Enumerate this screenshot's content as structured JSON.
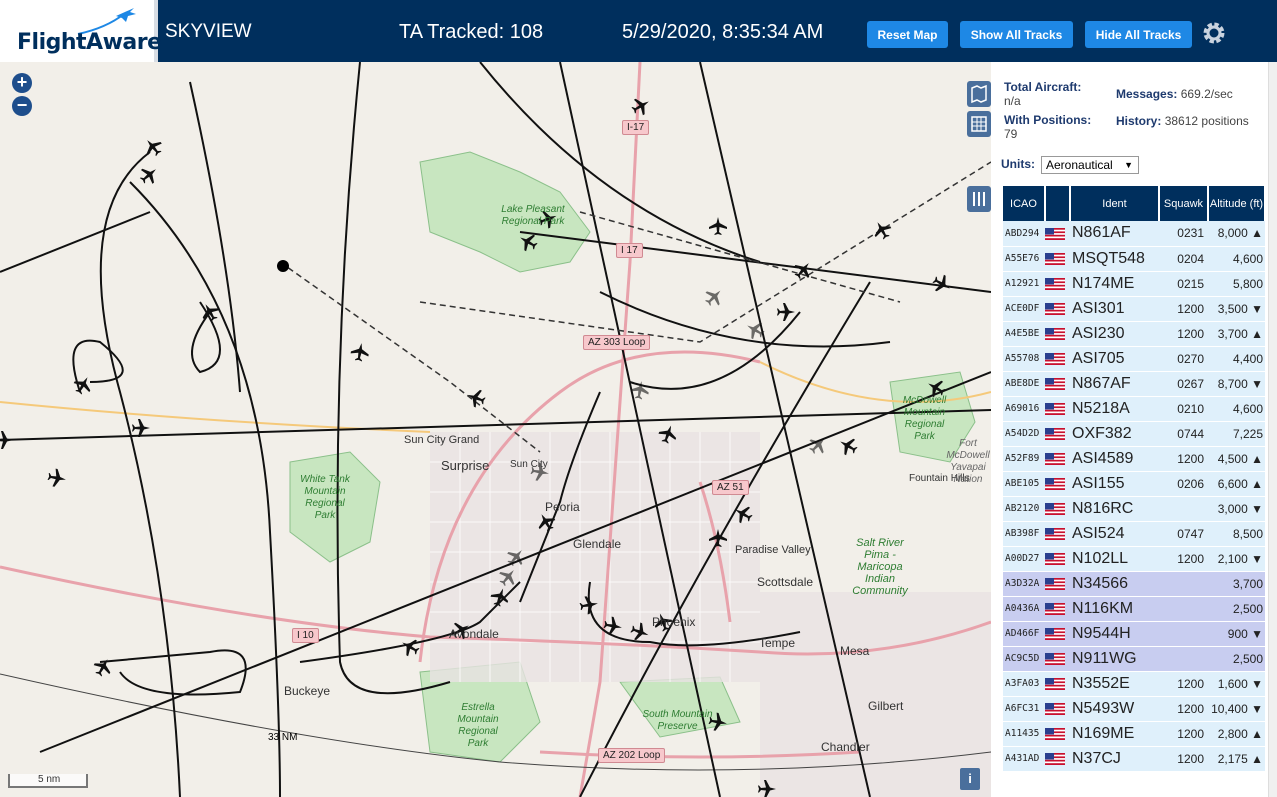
{
  "header": {
    "logo_text": "FlightAware",
    "app_title": "SKYVIEW",
    "ta_tracked": "TA Tracked: 108",
    "datetime": "5/29/2020, 8:35:34 AM",
    "buttons": {
      "reset": "Reset Map",
      "show_all": "Show All Tracks",
      "hide_all": "Hide All Tracks"
    }
  },
  "map": {
    "zoom_in": "+",
    "zoom_out": "−",
    "scale": "5 nm",
    "range_ring": "33 NM",
    "info": "i",
    "labels": [
      {
        "text": "Surprise"
      },
      {
        "text": "Sun City Grand"
      },
      {
        "text": "Sun City"
      },
      {
        "text": "Peoria"
      },
      {
        "text": "Glendale"
      },
      {
        "text": "Paradise Valley"
      },
      {
        "text": "Scottsdale"
      },
      {
        "text": "Phoenix"
      },
      {
        "text": "Tempe"
      },
      {
        "text": "Mesa"
      },
      {
        "text": "Gilbert"
      },
      {
        "text": "Chandler"
      },
      {
        "text": "Buckeye"
      },
      {
        "text": "Avondale"
      },
      {
        "text": "Fountain Hills"
      }
    ],
    "parks": [
      {
        "text": "Lake Pleasant Regional Park"
      },
      {
        "text": "White Tank Mountain Regional Park"
      },
      {
        "text": "McDowell Mountain Regional Park"
      },
      {
        "text": "Estrella Mountain Regional Park"
      },
      {
        "text": "South Mountain Preserve"
      },
      {
        "text": "Salt River Pima - Maricopa Indian Community"
      },
      {
        "text": "Fort McDowell Yavapai Nation"
      }
    ],
    "shields": [
      "I-17",
      "I 17",
      "AZ 303 Loop",
      "AZ 51",
      "I 10",
      "AZ 202 Loop"
    ]
  },
  "panel": {
    "total_aircraft_label": "Total Aircraft:",
    "total_aircraft_value": "n/a",
    "with_positions_label": "With Positions:",
    "with_positions_value": "79",
    "messages_label": "Messages:",
    "messages_value": "669.2/sec",
    "history_label": "History:",
    "history_value": "38612 positions",
    "units_label": "Units:",
    "units_value": "Aeronautical",
    "table_headers": {
      "icao": "ICAO",
      "ident": "Ident",
      "squawk": "Squawk",
      "altitude": "Altitude (ft)"
    },
    "rows": [
      {
        "icao": "ABD294",
        "ident": "N861AF",
        "squawk": "0231",
        "alt": "8,000 ▲",
        "sel": false
      },
      {
        "icao": "A55E76",
        "ident": "MSQT548",
        "squawk": "0204",
        "alt": "4,600",
        "sel": false
      },
      {
        "icao": "A12921",
        "ident": "N174ME",
        "squawk": "0215",
        "alt": "5,800",
        "sel": false
      },
      {
        "icao": "ACE0DF",
        "ident": "ASI301",
        "squawk": "1200",
        "alt": "3,500 ▼",
        "sel": false
      },
      {
        "icao": "A4E5BE",
        "ident": "ASI230",
        "squawk": "1200",
        "alt": "3,700 ▲",
        "sel": false
      },
      {
        "icao": "A55708",
        "ident": "ASI705",
        "squawk": "0270",
        "alt": "4,400",
        "sel": false
      },
      {
        "icao": "ABE8DE",
        "ident": "N867AF",
        "squawk": "0267",
        "alt": "8,700 ▼",
        "sel": false
      },
      {
        "icao": "A69016",
        "ident": "N5218A",
        "squawk": "0210",
        "alt": "4,600",
        "sel": false
      },
      {
        "icao": "A54D2D",
        "ident": "OXF382",
        "squawk": "0744",
        "alt": "7,225",
        "sel": false
      },
      {
        "icao": "A52F89",
        "ident": "ASI4589",
        "squawk": "1200",
        "alt": "4,500 ▲",
        "sel": false
      },
      {
        "icao": "ABE105",
        "ident": "ASI155",
        "squawk": "0206",
        "alt": "6,600 ▲",
        "sel": false
      },
      {
        "icao": "AB2120",
        "ident": "N816RC",
        "squawk": "",
        "alt": "3,000 ▼",
        "sel": false
      },
      {
        "icao": "AB398F",
        "ident": "ASI524",
        "squawk": "0747",
        "alt": "8,500",
        "sel": false
      },
      {
        "icao": "A00D27",
        "ident": "N102LL",
        "squawk": "1200",
        "alt": "2,100 ▼",
        "sel": false
      },
      {
        "icao": "A3D32A",
        "ident": "N34566",
        "squawk": "",
        "alt": "3,700",
        "sel": true
      },
      {
        "icao": "A0436A",
        "ident": "N116KM",
        "squawk": "",
        "alt": "2,500",
        "sel": true
      },
      {
        "icao": "AD466F",
        "ident": "N9544H",
        "squawk": "",
        "alt": "900 ▼",
        "sel": true
      },
      {
        "icao": "AC9C5D",
        "ident": "N911WG",
        "squawk": "",
        "alt": "2,500",
        "sel": true
      },
      {
        "icao": "A3FA03",
        "ident": "N3552E",
        "squawk": "1200",
        "alt": "1,600 ▼",
        "sel": false
      },
      {
        "icao": "A6FC31",
        "ident": "N5493W",
        "squawk": "1200",
        "alt": "10,400 ▼",
        "sel": false
      },
      {
        "icao": "A11435",
        "ident": "N169ME",
        "squawk": "1200",
        "alt": "2,800 ▲",
        "sel": false
      },
      {
        "icao": "A431AD",
        "ident": "N37CJ",
        "squawk": "1200",
        "alt": "2,175 ▲",
        "sel": false
      }
    ]
  },
  "colors": {
    "header_bg": "#002f5d",
    "button_bg": "#1e88e5",
    "row_bg": "#dff0fb",
    "row_selected_bg": "#c8cdf0"
  }
}
